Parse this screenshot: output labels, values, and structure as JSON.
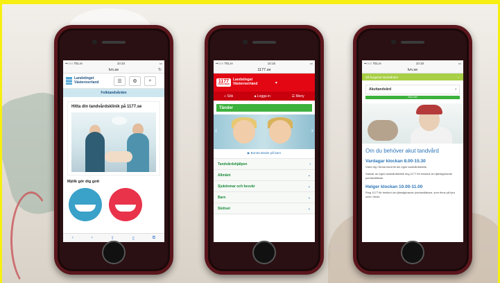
{
  "phone1": {
    "status": {
      "carrier": "••○○○ TELIA",
      "time": "10:10"
    },
    "url": "lvn.se",
    "logo_text": "Landstinget Västernorrland",
    "nav_label": "Folktandvården",
    "card_title": "Hitta din tandvårdsklinik på 1177.se",
    "section_title": "Mjölk gör dig gott"
  },
  "phone2": {
    "status": {
      "carrier": "••○○○ TELIA",
      "time": "10:16"
    },
    "url": "1177.se",
    "badge_number": "1177",
    "badge_sub": "VÅRDGUIDEN",
    "region": "Landstinget Västernorrland",
    "menu": {
      "search": "Sök",
      "login": "Logga in",
      "menu": "Meny"
    },
    "title": "Tänder",
    "caption": "Borsta tänder på barn",
    "items": [
      "Tandvårdshjälpen",
      "Allmänt",
      "Sjukdomar och besvär",
      "Barn",
      "Skötsel"
    ]
  },
  "phone3": {
    "status": {
      "carrier": "••○○○ TELIA",
      "time": "10:18"
    },
    "url": "lvn.se",
    "green_bar": "Så fungerar tandvården",
    "row_label": "Akuttandvård",
    "more": "Visa mer",
    "heading": "Om du behöver akut tandvård",
    "sub1": "Vardagar klockan 8.00-15.30",
    "para1": "Vänd dig i första hand till din egen tandvårdsklinik.",
    "para2": "Saknar du egen tandvårdsklinik ring 1177 för besked om tjänstgörande jourtandläkare.",
    "sub2": "Helger klockan 10.00-11.00",
    "para3": "Ring 1177 för besked om tjänstgörande jourtandläkare, som finns på fyra orter i länet."
  }
}
